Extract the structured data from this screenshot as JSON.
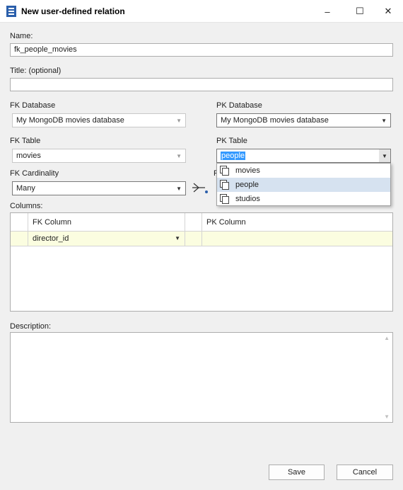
{
  "window": {
    "title": "New user-defined relation",
    "minimize": "–",
    "maximize": "☐",
    "close": "✕"
  },
  "name": {
    "label": "Name:",
    "value": "fk_people_movies"
  },
  "title_field": {
    "label": "Title: (optional)",
    "value": ""
  },
  "fk_database": {
    "label": "FK Database",
    "value": "My MongoDB movies database"
  },
  "pk_database": {
    "label": "PK Database",
    "value": "My MongoDB movies database"
  },
  "fk_table": {
    "label": "FK Table",
    "value": "movies"
  },
  "pk_table": {
    "label": "PK Table",
    "value": "people",
    "options": [
      "movies",
      "people",
      "studios"
    ],
    "highlighted": "people"
  },
  "fk_cardinality": {
    "label": "FK Cardinality",
    "value": "Many"
  },
  "pk_cardinality_partial_label": "P",
  "columns": {
    "label": "Columns:",
    "headers": [
      "FK Column",
      "PK Column"
    ],
    "rows": [
      {
        "fk": "director_id",
        "pk": ""
      }
    ]
  },
  "description": {
    "label": "Description:",
    "value": ""
  },
  "buttons": {
    "save": "Save",
    "cancel": "Cancel"
  },
  "colors": {
    "selection": "#3399ff",
    "row_highlight": "#fbfde0",
    "popup_selected": "#d6e2f0",
    "icon_blue": "#2b5fab"
  },
  "icons": [
    "app-icon",
    "dropdown-arrow-icon",
    "relation-connector-icon",
    "table-icon",
    "scroll-up-icon",
    "scroll-down-icon"
  ]
}
